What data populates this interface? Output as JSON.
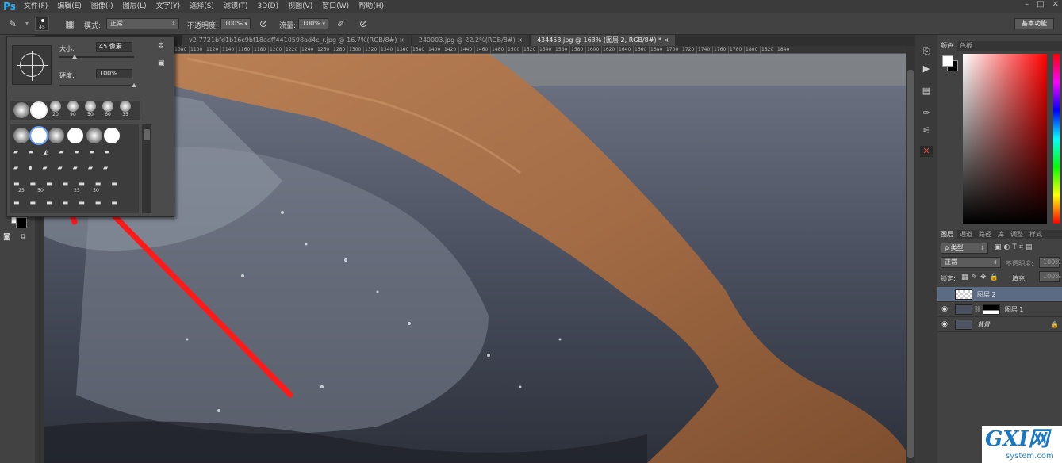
{
  "app": {
    "logo": "Ps"
  },
  "menu": [
    "文件(F)",
    "编辑(E)",
    "图像(I)",
    "图层(L)",
    "文字(Y)",
    "选择(S)",
    "滤镜(T)",
    "3D(D)",
    "视图(V)",
    "窗口(W)",
    "帮助(H)"
  ],
  "window_controls": [
    "–",
    "□",
    "✕"
  ],
  "options": {
    "brush_size_badge": "45",
    "mode_label": "模式:",
    "mode_value": "正常",
    "opacity_label": "不透明度:",
    "opacity_value": "100%",
    "flow_label": "流量:",
    "flow_value": "100%",
    "workspace": "基本功能"
  },
  "tabs": [
    {
      "label": "v2-7721bfd1b16c9bf18adff4410598ad4c_r.jpg @ 16.7%(RGB/8#)",
      "close": "×"
    },
    {
      "label": "240003.jpg @ 22.2%(RGB/8#)",
      "close": "×"
    },
    {
      "label": "434453.jpg @ 163% (图层 2, RGB/8#) *",
      "close": "×"
    }
  ],
  "ruler_top": [
    "1080",
    "1100",
    "1120",
    "1140",
    "1160",
    "1180",
    "1200",
    "1220",
    "1240",
    "1260",
    "1280",
    "1300",
    "1320",
    "1340",
    "1360",
    "1380",
    "1400",
    "1420",
    "1440",
    "1460",
    "1480",
    "1500",
    "1520",
    "1540",
    "1560",
    "1580",
    "1600",
    "1620",
    "1640",
    "1660",
    "1680",
    "1700",
    "1720",
    "1740",
    "1760",
    "1780",
    "1800",
    "1820",
    "1840"
  ],
  "brush_popup": {
    "size_label": "大小:",
    "size_value": "45 像素",
    "hardness_label": "硬度:",
    "hardness_value": "100%",
    "size_fraction": 0.2,
    "hardness_fraction": 1.0,
    "row1_sizes": [
      "20",
      "90",
      "50",
      "60",
      "35"
    ],
    "row_sizes": [
      "25",
      "50",
      "25",
      "50"
    ]
  },
  "color_panel": {
    "tabs": [
      "颜色",
      "色板"
    ],
    "fg": "#ffffff",
    "bg": "#000000"
  },
  "layers_panel": {
    "tabs": [
      "图层",
      "通道",
      "路径",
      "库",
      "调整",
      "样式"
    ],
    "filter": "ρ 类型",
    "blend_mode": "正常",
    "opacity_label": "不透明度:",
    "opacity_value": "100%",
    "lock_label": "锁定:",
    "fill_label": "填充:",
    "fill_value": "100%",
    "layers": [
      {
        "name": "图层 2",
        "selected": true
      },
      {
        "name": "图层 1",
        "selected": false
      },
      {
        "name": "背景",
        "selected": false
      }
    ]
  },
  "watermark": {
    "brand": "GXI网",
    "domain": "system.com"
  },
  "colors": {
    "accent": "#1fb3ff",
    "arrow": "#ff1a1a"
  }
}
